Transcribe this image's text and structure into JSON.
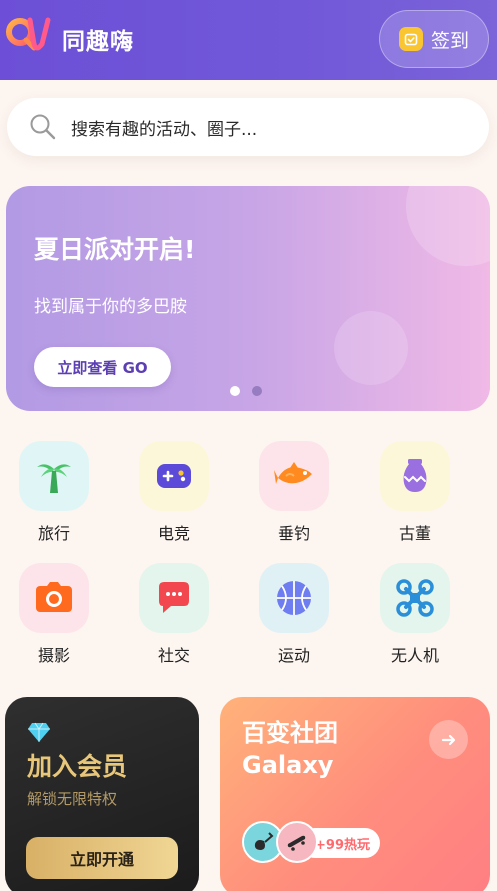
{
  "header": {
    "app_name": "同趣嗨",
    "logo_icon": "qu-logo-icon",
    "checkin_label": "签到",
    "colors": {
      "header_bg": "#6c4fd6",
      "checkin_icon": "#f9c531"
    }
  },
  "search": {
    "placeholder": "搜索有趣的活动、圈子..."
  },
  "banner": {
    "title": "夏日派对开启!",
    "subtitle": "找到属于你的多巴胺",
    "cta_label": "立即查看 GO",
    "page_count": 2,
    "active_page": 1
  },
  "categories": [
    {
      "label": "旅行",
      "icon": "palm-tree-icon",
      "tile_color": "#e0f6f6"
    },
    {
      "label": "电竞",
      "icon": "gamepad-icon",
      "tile_color": "#fdf7d9"
    },
    {
      "label": "垂钓",
      "icon": "fish-icon",
      "tile_color": "#fde4ea"
    },
    {
      "label": "古董",
      "icon": "vase-icon",
      "tile_color": "#fdf7d9"
    },
    {
      "label": "摄影",
      "icon": "camera-icon",
      "tile_color": "#fde4ea"
    },
    {
      "label": "社交",
      "icon": "chat-bubble-icon",
      "tile_color": "#e3f5ec"
    },
    {
      "label": "运动",
      "icon": "basketball-icon",
      "tile_color": "#e0f1f6"
    },
    {
      "label": "无人机",
      "icon": "drone-icon",
      "tile_color": "#e3f5ec"
    }
  ],
  "vip_card": {
    "title": "加入会员",
    "subtitle": "解锁无限特权",
    "button_label": "立即开通",
    "icon": "diamond-icon"
  },
  "galaxy_card": {
    "title_line1": "百变社团",
    "title_line2": "Galaxy",
    "badge_text": "+99热玩",
    "avatars": [
      "guitar-icon",
      "skateboard-icon"
    ]
  }
}
